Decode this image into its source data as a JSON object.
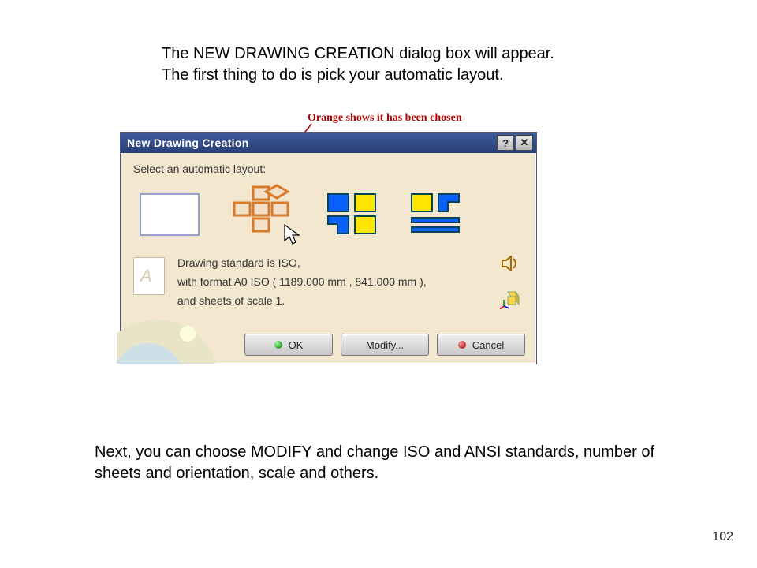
{
  "intro": {
    "line1": "The NEW DRAWING CREATION dialog box will appear.",
    "line2": "The first thing to do is pick your automatic layout."
  },
  "annotation": "Orange shows it has been chosen",
  "dialog": {
    "title": "New Drawing Creation",
    "select_label": "Select an automatic layout:",
    "info_line1": "Drawing standard is ISO,",
    "info_line2": "with format A0 ISO ( 1189.000 mm , 841.000 mm ),",
    "info_line3": "and sheets of scale 1.",
    "buttons": {
      "ok": "OK",
      "modify": "Modify...",
      "cancel": "Cancel"
    },
    "help_char": "?",
    "close_char": "✕"
  },
  "outro": "Next, you can choose MODIFY and change ISO and ANSI standards, number of sheets and orientation, scale and others.",
  "page_number": "102"
}
